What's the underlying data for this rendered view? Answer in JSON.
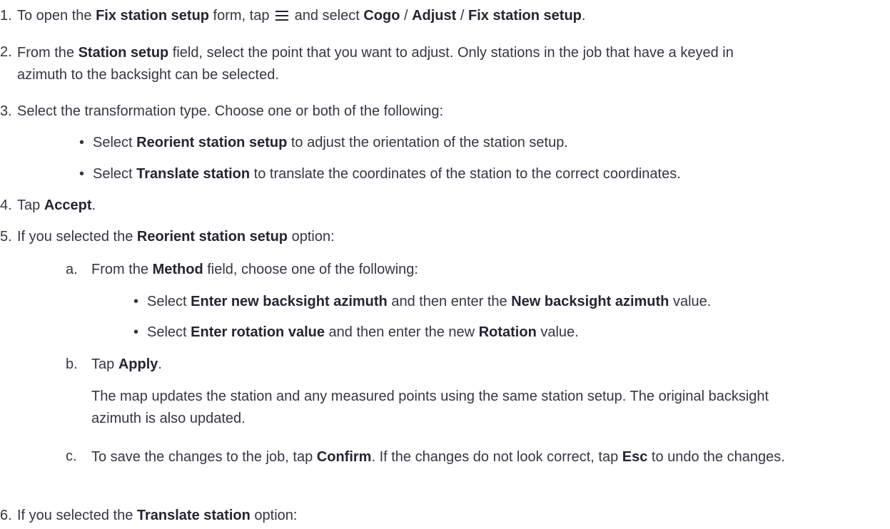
{
  "steps": {
    "s1": {
      "num": "1.",
      "t1": "To open the ",
      "b1": "Fix station setup",
      "t2": " form, tap ",
      "icon": "menu-icon",
      "t3": " and select ",
      "b2": "Cogo",
      "t4": " / ",
      "b3": "Adjust",
      "t5": " / ",
      "b4": "Fix station setup",
      "t6": "."
    },
    "s2": {
      "num": "2.",
      "t1": "From the ",
      "b1": "Station setup",
      "t2": " field, select the point that you want to adjust. Only stations in the job that have a keyed in azimuth to the backsight can be selected."
    },
    "s3": {
      "num": "3.",
      "t1": "Select the transformation type. Choose one or both of the following:",
      "bullets": [
        {
          "t1": "Select ",
          "b1": "Reorient station setup",
          "t2": " to adjust the orientation of the station setup."
        },
        {
          "t1": "Select ",
          "b1": "Translate station",
          "t2": " to translate the coordinates of the station to the correct coordinates."
        }
      ]
    },
    "s4": {
      "num": "4.",
      "t1": "Tap ",
      "b1": "Accept",
      "t2": "."
    },
    "s5": {
      "num": "5.",
      "t1": "If you selected the ",
      "b1": "Reorient station setup",
      "t2": " option:",
      "a": {
        "letter": "a.",
        "t1": "From the ",
        "b1": "Method",
        "t2": " field, choose one of the following:",
        "bullets": [
          {
            "t1": "Select ",
            "b1": "Enter new backsight azimuth",
            "t2": " and then enter the ",
            "b2": "New backsight azimuth",
            "t3": " value."
          },
          {
            "t1": "Select ",
            "b1": "Enter rotation value",
            "t2": " and then enter the new ",
            "b2": "Rotation",
            "t3": " value."
          }
        ]
      },
      "b": {
        "letter": "b.",
        "t1": "Tap ",
        "b1": "Apply",
        "t2": ".",
        "note": "The map updates the station and any measured points using the same station setup. The original backsight azimuth is also updated."
      },
      "c": {
        "letter": "c.",
        "t1": "To save the changes to the job, tap ",
        "b1": "Confirm",
        "t2": ". If the changes do not look correct, tap ",
        "b2": "Esc",
        "t3": " to undo the changes."
      }
    },
    "s6": {
      "num": "6.",
      "t1": "If you selected the ",
      "b1": "Translate station",
      "t2": " option:"
    }
  }
}
